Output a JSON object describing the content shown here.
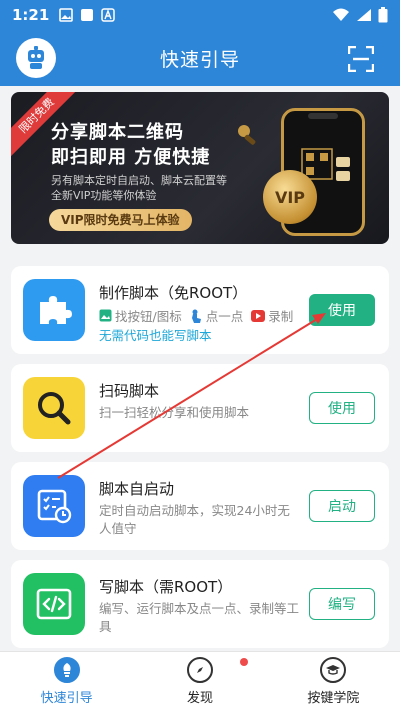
{
  "status": {
    "time": "1:21"
  },
  "header": {
    "title": "快速引导"
  },
  "banner": {
    "ribbon": "限时免费",
    "title": "分享脚本二维码",
    "subtitle": "即扫即用 方便快捷",
    "desc_line1": "另有脚本定时自启动、脚本云配置等",
    "desc_line2": "全新VIP功能等你体验",
    "cta": "VIP限时免费马上体验",
    "coin_text": "VIP"
  },
  "cards": [
    {
      "title": "制作脚本（免ROOT）",
      "tags": [
        "找按钮/图标",
        "点一点",
        "录制"
      ],
      "note": "无需代码也能写脚本",
      "button": "使用",
      "icon": "puzzle-icon"
    },
    {
      "title": "扫码脚本",
      "desc": "扫一扫轻松分享和使用脚本",
      "button": "使用",
      "icon": "magnifier-icon"
    },
    {
      "title": "脚本自启动",
      "desc": "定时自动启动脚本，实现24小时无人值守",
      "button": "启动",
      "icon": "schedule-icon"
    },
    {
      "title": "写脚本（需ROOT）",
      "desc": "编写、运行脚本及点一点、录制等工具",
      "button": "编写",
      "icon": "code-icon"
    }
  ],
  "tabs": [
    {
      "label": "快速引导",
      "icon": "guide-icon"
    },
    {
      "label": "发现",
      "icon": "compass-icon"
    },
    {
      "label": "按键学院",
      "icon": "academy-icon"
    }
  ],
  "colors": {
    "primary": "#2e86d8",
    "accent": "#21b183",
    "highlight": "#1ea7d8"
  }
}
